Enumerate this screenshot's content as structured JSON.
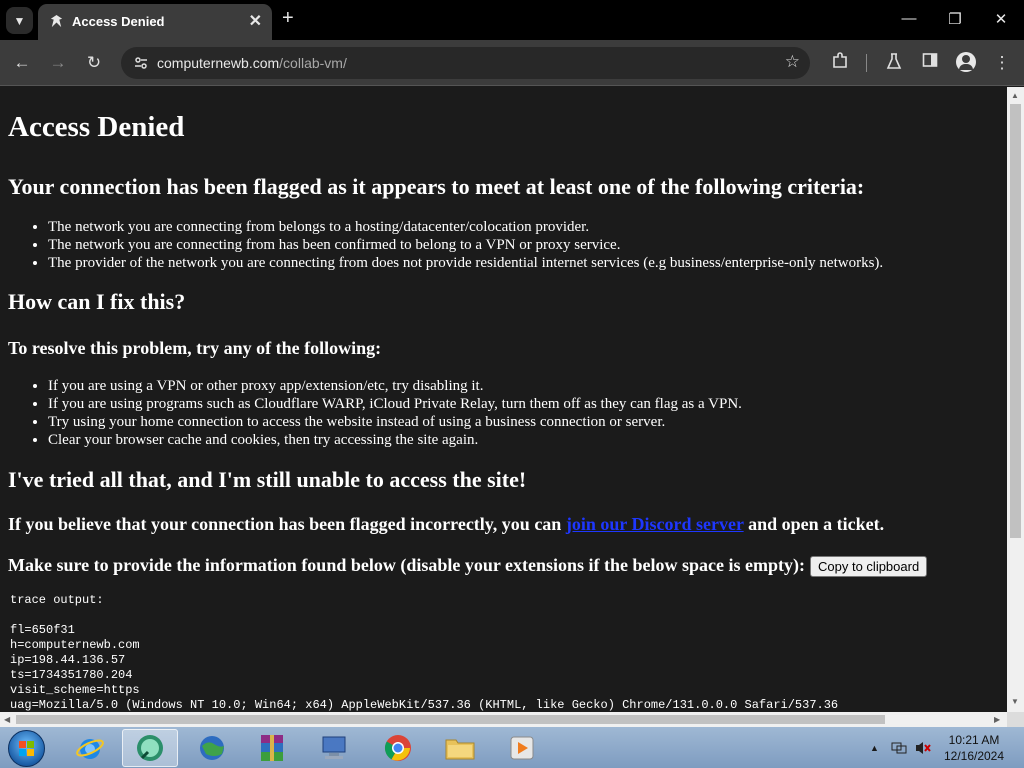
{
  "browser": {
    "tab_title": "Access Denied",
    "url_host": "computernewb.com",
    "url_path": "/collab-vm/"
  },
  "page": {
    "h1": "Access Denied",
    "criteria_heading": "Your connection has been flagged as it appears to meet at least one of the following criteria:",
    "criteria": [
      "The network you are connecting from belongs to a hosting/datacenter/colocation provider.",
      "The network you are connecting from has been confirmed to belong to a VPN or proxy service.",
      "The provider of the network you are connecting from does not provide residential internet services (e.g business/enterprise-only networks)."
    ],
    "fix_heading": "How can I fix this?",
    "resolve_heading": "To resolve this problem, try any of the following:",
    "fixes": [
      "If you are using a VPN or other proxy app/extension/etc, try disabling it.",
      "If you are using programs such as Cloudflare WARP, iCloud Private Relay, turn them off as they can flag as a VPN.",
      "Try using your home connection to access the website instead of using a business connection or server.",
      "Clear your browser cache and cookies, then try accessing the site again."
    ],
    "tried_heading": "I've tried all that, and I'm still unable to access the site!",
    "incorrect_before": "If you believe that your connection has been flagged incorrectly, you can ",
    "incorrect_link": "join our Discord server",
    "incorrect_after": " and open a ticket.",
    "provide_text": "Make sure to provide the information found below (disable your extensions if the below space is empty):",
    "copy_button": "Copy to clipboard",
    "trace_label": "trace output:",
    "trace_lines": [
      "fl=650f31",
      "h=computernewb.com",
      "ip=198.44.136.57",
      "ts=1734351780.204",
      "visit_scheme=https",
      "uag=Mozilla/5.0 (Windows NT 10.0; Win64; x64) AppleWebKit/537.36 (KHTML, like Gecko) Chrome/131.0.0.0 Safari/537.36"
    ]
  },
  "taskbar": {
    "time": "10:21 AM",
    "date": "12/16/2024",
    "apps": [
      "ie-icon",
      "collabvm-icon",
      "network-globe-icon",
      "winrar-icon",
      "computer-icon",
      "chrome-icon",
      "explorer-folder-icon",
      "media-player-icon"
    ]
  },
  "colors": {
    "page_bg": "#1b1b1b",
    "link": "#1e37ff",
    "toolbar": "#3c3c3c",
    "titlebar": "#000000"
  }
}
